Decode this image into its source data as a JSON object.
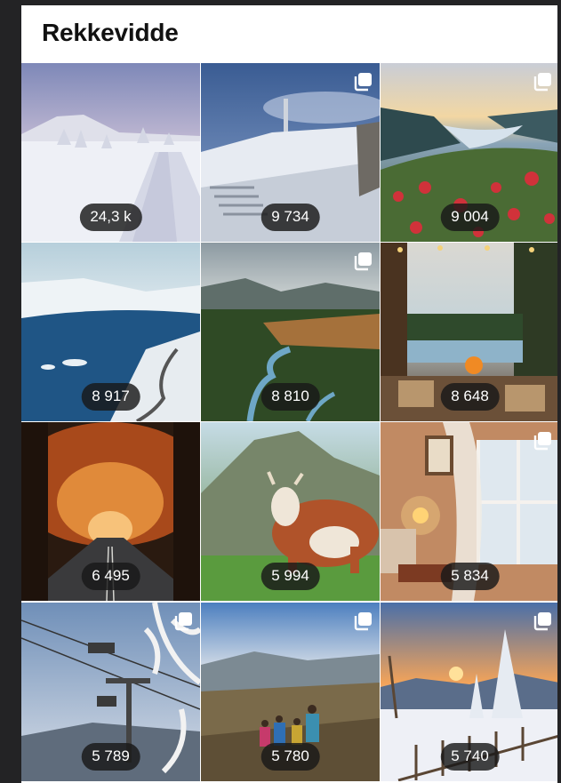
{
  "header": {
    "title": "Rekkevidde"
  },
  "posts": [
    {
      "count": "24,3 k",
      "multi": false,
      "scene": "snow-road"
    },
    {
      "count": "9 734",
      "multi": true,
      "scene": "snow-mountain-stairs"
    },
    {
      "count": "9 004",
      "multi": true,
      "scene": "fjord-sunset-berries"
    },
    {
      "count": "8 917",
      "multi": false,
      "scene": "frozen-lake-road"
    },
    {
      "count": "8 810",
      "multi": true,
      "scene": "river-valley-forest"
    },
    {
      "count": "8 648",
      "multi": false,
      "scene": "cabin-terrace-fire"
    },
    {
      "count": "6 495",
      "multi": false,
      "scene": "autumn-tree-tunnel"
    },
    {
      "count": "5 994",
      "multi": false,
      "scene": "cow-mountain"
    },
    {
      "count": "5 834",
      "multi": true,
      "scene": "cozy-room-window"
    },
    {
      "count": "5 789",
      "multi": true,
      "scene": "ski-lift-frost"
    },
    {
      "count": "5 780",
      "multi": true,
      "scene": "hikers-mountain"
    },
    {
      "count": "5 740",
      "multi": true,
      "scene": "snowy-sunset-fence"
    }
  ]
}
